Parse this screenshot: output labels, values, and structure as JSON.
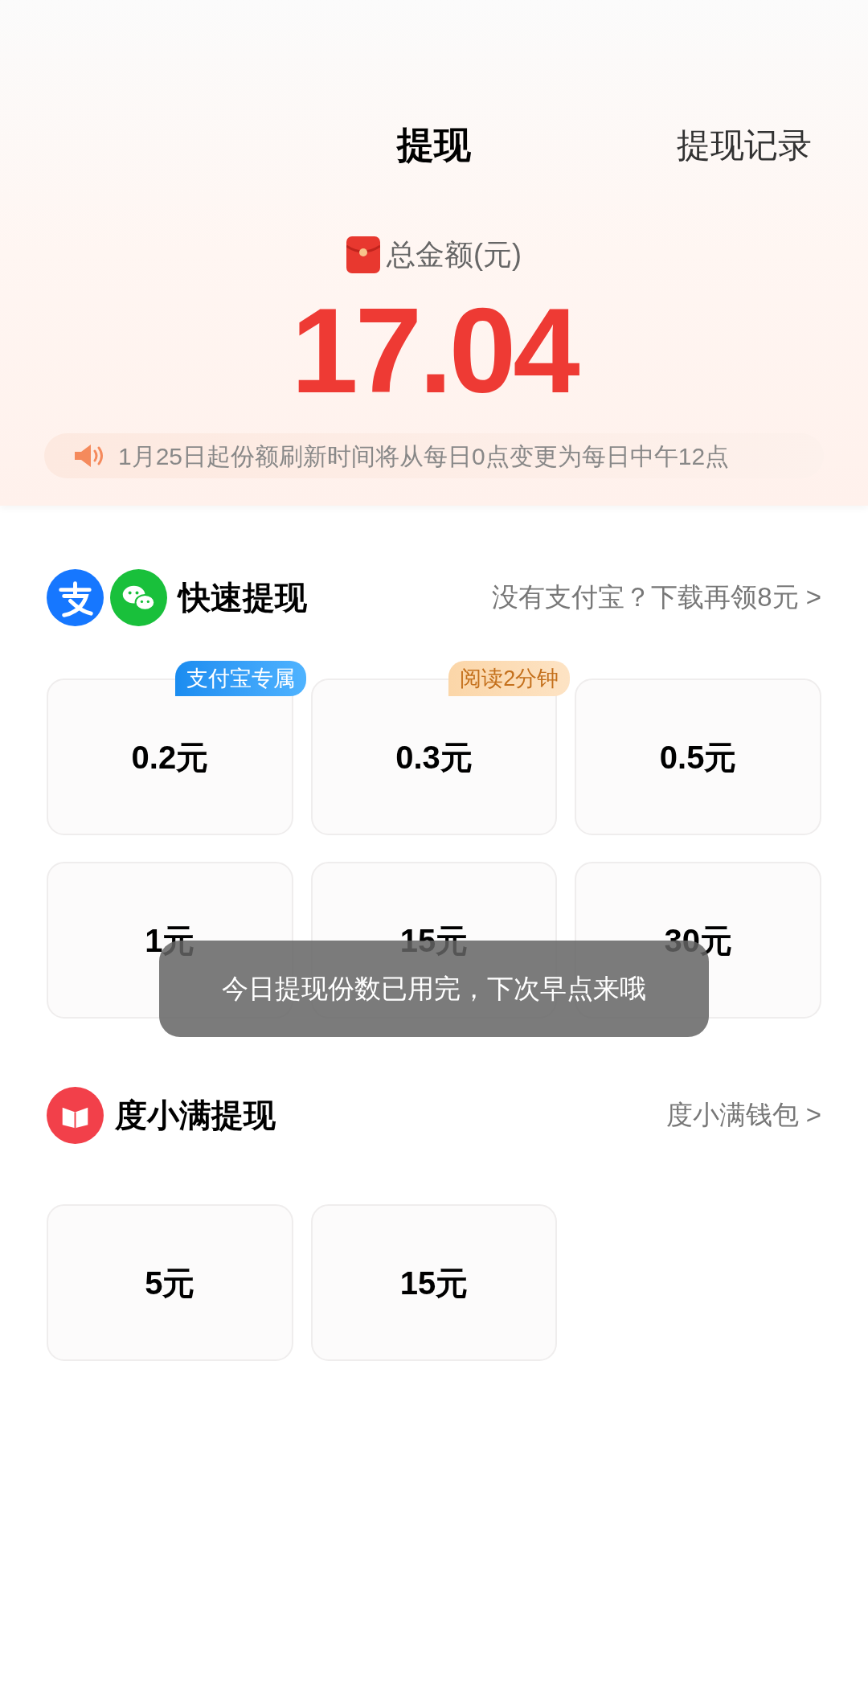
{
  "header": {
    "title": "提现",
    "record_link": "提现记录"
  },
  "balance": {
    "label": "总金额(元)",
    "amount": "17.04"
  },
  "notice": {
    "text": "1月25日起份额刷新时间将从每日0点变更为每日中午12点"
  },
  "sections": [
    {
      "kind": "quick",
      "title": "快速提现",
      "link": "没有支付宝？下载再领8元 >",
      "options": [
        {
          "amount": "0.2元",
          "tag": {
            "text": "支付宝专属",
            "kind": "blue"
          }
        },
        {
          "amount": "0.3元",
          "tag": {
            "text": "阅读2分钟",
            "kind": "orange"
          }
        },
        {
          "amount": "0.5元"
        },
        {
          "amount": "1元"
        },
        {
          "amount": "15元"
        },
        {
          "amount": "30元"
        }
      ]
    },
    {
      "kind": "wallet",
      "title": "度小满提现",
      "link": "度小满钱包 >",
      "options": [
        {
          "amount": "5元"
        },
        {
          "amount": "15元"
        }
      ]
    }
  ],
  "toast": {
    "text": "今日提现份数已用完，下次早点来哦"
  }
}
